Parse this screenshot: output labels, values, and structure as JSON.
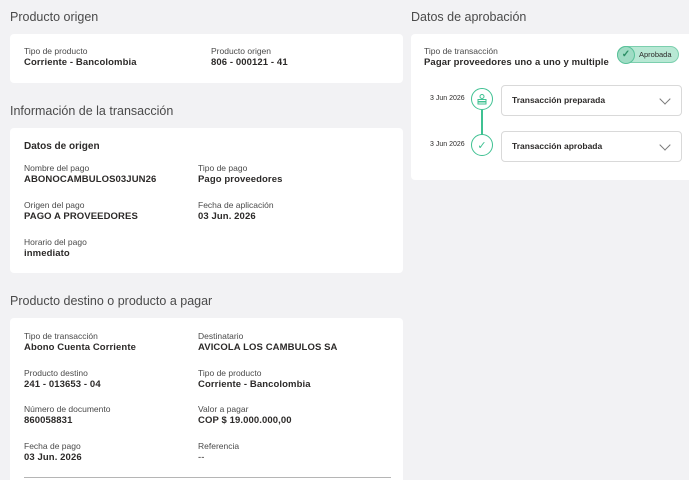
{
  "origin": {
    "title": "Producto origen",
    "product_type_label": "Tipo de producto",
    "product_type_value": "Corriente - Bancolombia",
    "origin_product_label": "Producto origen",
    "origin_product_value": "806 - 000121 - 41"
  },
  "transaction_info": {
    "title": "Información de la transacción",
    "subhead": "Datos de origen",
    "payment_name_label": "Nombre del pago",
    "payment_name_value": "ABONOCAMBULOS03JUN26",
    "payment_type_label": "Tipo de pago",
    "payment_type_value": "Pago proveedores",
    "payment_origin_label": "Origen del pago",
    "payment_origin_value": "PAGO A PROVEEDORES",
    "apply_date_label": "Fecha de aplicación",
    "apply_date_value": "03 Jun. 2026",
    "schedule_label": "Horario del pago",
    "schedule_value": "inmediato"
  },
  "destination": {
    "title": "Producto destino o producto a pagar",
    "tx_type_label": "Tipo de transacción",
    "tx_type_value": "Abono Cuenta Corriente",
    "recipient_label": "Destinatario",
    "recipient_value": "AVICOLA LOS CAMBULOS SA",
    "dest_product_label": "Producto destino",
    "dest_product_value": "241 - 013653 - 04",
    "product_type_label": "Tipo de producto",
    "product_type_value": "Corriente - Bancolombia",
    "doc_number_label": "Número de documento",
    "doc_number_value": "860058831",
    "amount_label": "Valor a pagar",
    "amount_value": "COP $ 19.000.000,00",
    "pay_date_label": "Fecha de pago",
    "pay_date_value": "03 Jun. 2026",
    "reference_label": "Referencia",
    "reference_value": "--"
  },
  "approval": {
    "title": "Datos de aprobación",
    "tx_type_label": "Tipo de transacción",
    "tx_type_value": "Pagar proveedores uno a uno y multiple",
    "status_badge": "Aprobada",
    "status_color": "#3fc192",
    "steps": [
      {
        "date": "3 Jun 2026",
        "label": "Transacción preparada",
        "icon": "user-stack-icon"
      },
      {
        "date": "3 Jun 2026",
        "label": "Transacción aprobada",
        "icon": "check-icon"
      }
    ]
  }
}
